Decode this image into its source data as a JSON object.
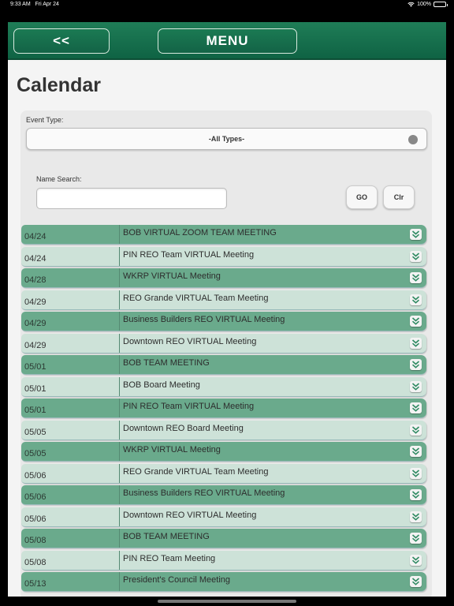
{
  "status": {
    "time": "9:33 AM",
    "date": "Fri Apr 24",
    "battery": "100%"
  },
  "nav": {
    "back_label": "<<",
    "menu_label": "MENU"
  },
  "page_title": "Calendar",
  "filters": {
    "event_type_label": "Event Type:",
    "event_type_value": "-All Types-",
    "name_search_label": "Name Search:",
    "name_search_value": "",
    "go_label": "GO",
    "clear_label": "Clr"
  },
  "events": [
    {
      "date": "04/24",
      "title": "BOB VIRTUAL ZOOM TEAM MEETING",
      "shade": "dark"
    },
    {
      "date": "04/24",
      "title": "PIN REO Team VIRTUAL Meeting",
      "shade": "light"
    },
    {
      "date": "04/28",
      "title": "WKRP VIRTUAL Meeting",
      "shade": "dark"
    },
    {
      "date": "04/29",
      "title": "REO Grande VIRTUAL Team Meeting",
      "shade": "light"
    },
    {
      "date": "04/29",
      "title": "Business Builders REO VIRTUAL Meeting",
      "shade": "dark"
    },
    {
      "date": "04/29",
      "title": "Downtown REO VIRTUAL Meeting",
      "shade": "light"
    },
    {
      "date": "05/01",
      "title": "BOB TEAM MEETING",
      "shade": "dark"
    },
    {
      "date": "05/01",
      "title": "BOB Board Meeting",
      "shade": "light"
    },
    {
      "date": "05/01",
      "title": "PIN REO Team VIRTUAL Meeting",
      "shade": "dark"
    },
    {
      "date": "05/05",
      "title": "Downtown REO Board Meeting",
      "shade": "light"
    },
    {
      "date": "05/05",
      "title": "WKRP VIRTUAL Meeting",
      "shade": "dark"
    },
    {
      "date": "05/06",
      "title": "REO Grande VIRTUAL Team Meeting",
      "shade": "light"
    },
    {
      "date": "05/06",
      "title": "Business Builders REO VIRTUAL Meeting",
      "shade": "dark"
    },
    {
      "date": "05/06",
      "title": "Downtown REO VIRTUAL Meeting",
      "shade": "light"
    },
    {
      "date": "05/08",
      "title": "BOB TEAM MEETING",
      "shade": "dark"
    },
    {
      "date": "05/08",
      "title": "PIN REO Team Meeting",
      "shade": "light"
    },
    {
      "date": "05/13",
      "title": "President's Council Meeting",
      "shade": "dark"
    }
  ],
  "icons": {
    "row_action": "chevron-double-down-icon",
    "select_indicator": "radio-dot-icon"
  },
  "colors": {
    "header_green": "#0f6344",
    "row_dark": "#6aaa8c",
    "row_light": "#cde2d8"
  }
}
